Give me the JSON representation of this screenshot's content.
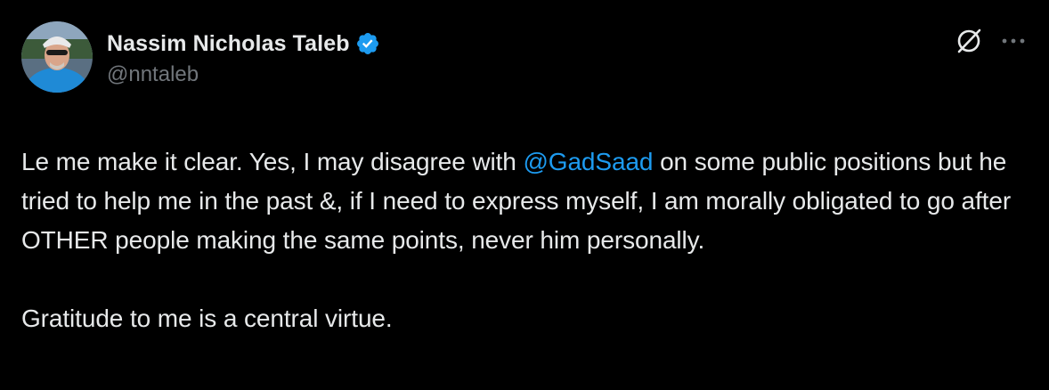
{
  "author": {
    "display_name": "Nassim Nicholas Taleb",
    "handle": "@nntaleb",
    "verified": true,
    "avatar_icon": "avatar-photo"
  },
  "actions": {
    "grok_icon": "grok-icon",
    "more_icon": "more-icon"
  },
  "tweet": {
    "p1_before": "Le me make it clear. Yes, I may disagree with ",
    "mention": "@GadSaad",
    "p1_after": " on some public positions but he tried to help me in the past &, if I need to express myself, I am morally obligated to go after OTHER people making the same points, never him personally.",
    "p2": "Gratitude to me is a central virtue."
  },
  "colors": {
    "background": "#000000",
    "text": "#e7e9ea",
    "secondary": "#71767b",
    "accent": "#1d9bf0"
  }
}
